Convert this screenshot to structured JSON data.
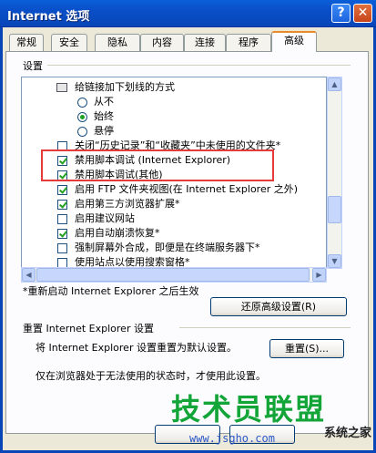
{
  "window": {
    "title": "Internet 选项",
    "help_label": "?",
    "close_label": "✕"
  },
  "tabs": [
    {
      "label": "常规"
    },
    {
      "label": "安全"
    },
    {
      "label": "隐私"
    },
    {
      "label": "内容"
    },
    {
      "label": "连接"
    },
    {
      "label": "程序"
    },
    {
      "label": "高级",
      "active": true
    }
  ],
  "settings": {
    "group_label": "设置",
    "items": [
      {
        "type": "header",
        "label": "给链接加下划线的方式"
      },
      {
        "type": "radio",
        "label": "从不",
        "checked": false
      },
      {
        "type": "radio",
        "label": "始终",
        "checked": true
      },
      {
        "type": "radio",
        "label": "悬停",
        "checked": false
      },
      {
        "type": "checkbox",
        "label": "关闭“历史记录”和“收藏夹”中未使用的文件夹*",
        "checked": false
      },
      {
        "type": "checkbox",
        "label": "禁用脚本调试 (Internet Explorer)",
        "checked": true
      },
      {
        "type": "checkbox",
        "label": "禁用脚本调试(其他)",
        "checked": true
      },
      {
        "type": "checkbox",
        "label": "启用 FTP 文件夹视图(在 Internet Explorer 之外)",
        "checked": true
      },
      {
        "type": "checkbox",
        "label": "启用第三方浏览器扩展*",
        "checked": true
      },
      {
        "type": "checkbox",
        "label": "启用建议网站",
        "checked": false
      },
      {
        "type": "checkbox",
        "label": "启用自动崩溃恢复*",
        "checked": true
      },
      {
        "type": "checkbox",
        "label": "强制屏幕外合成，即便是在终端服务器下*",
        "checked": false
      },
      {
        "type": "checkbox",
        "label": "使用站点以使用搜索窗格*",
        "checked": false
      }
    ],
    "restart_note": "*重新启动 Internet Explorer 之后生效",
    "restore_button": "还原高级设置(R)"
  },
  "reset": {
    "group_label": "重置 Internet Explorer 设置",
    "description": "将 Internet Explorer 设置重置为默认设置。",
    "button": "重置(S)...",
    "note": "仅在浏览器处于无法使用的状态时，才使用此设置。"
  },
  "watermark": {
    "main": "技术员联盟",
    "url": "www.jsgho.com",
    "site": "系统之家"
  },
  "colors": {
    "title_bar": "#0a4fc8",
    "highlight_box": "#e53b3b",
    "check": "#21a121"
  }
}
